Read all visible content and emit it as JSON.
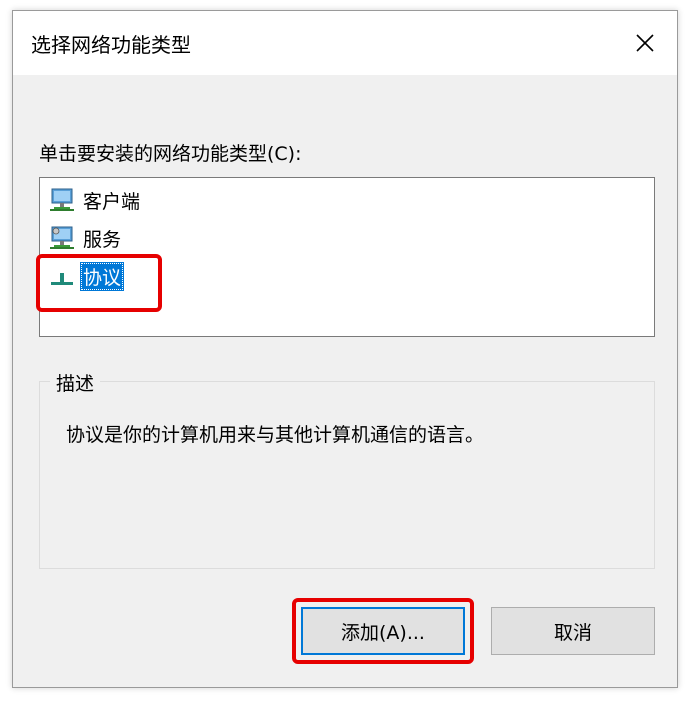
{
  "dialog": {
    "title": "选择网络功能类型",
    "close_icon": "close-icon"
  },
  "prompt": {
    "label": "单击要安装的网络功能类型(C):"
  },
  "list": {
    "items": [
      {
        "label": "客户端",
        "icon": "network-client-icon",
        "selected": false
      },
      {
        "label": "服务",
        "icon": "network-service-icon",
        "selected": false
      },
      {
        "label": "协议",
        "icon": "network-protocol-icon",
        "selected": true
      }
    ]
  },
  "description": {
    "group_title": "描述",
    "text": "协议是你的计算机用来与其他计算机通信的语言。"
  },
  "buttons": {
    "add_label": "添加(A)...",
    "cancel_label": "取消"
  },
  "colors": {
    "selection": "#0078d7",
    "highlight": "#e60000",
    "dialog_bg": "#f0f0f0"
  }
}
